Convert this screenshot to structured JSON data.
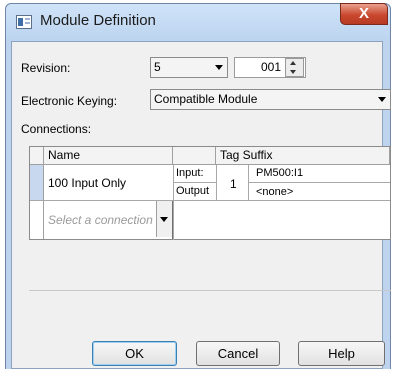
{
  "window": {
    "title": "Module Definition",
    "close_label": "X"
  },
  "revision": {
    "label": "Revision:",
    "major": "5",
    "minor": "001"
  },
  "keying": {
    "label": "Electronic Keying:",
    "value": "Compatible Module"
  },
  "connections": {
    "label": "Connections:",
    "headers": {
      "name": "Name",
      "tag_suffix": "Tag Suffix"
    },
    "row": {
      "name": "100 Input Only",
      "input_label": "Input:",
      "output_label": "Output",
      "rpi": "1",
      "input_tag": "PM500:I1",
      "output_tag": "<none>"
    },
    "new_row_placeholder": "Select a connection"
  },
  "buttons": {
    "ok": "OK",
    "cancel": "Cancel",
    "help": "Help"
  }
}
